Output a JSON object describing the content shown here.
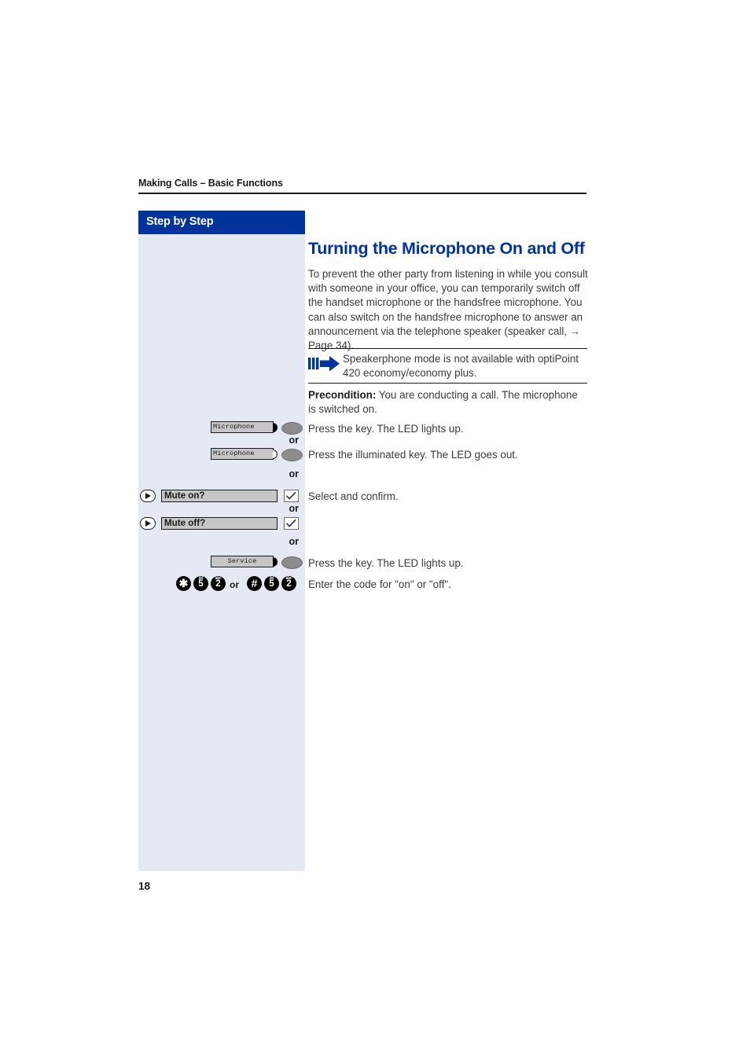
{
  "header": {
    "running_head": "Making Calls – Basic Functions"
  },
  "sidebar": {
    "title": "Step by Step",
    "bg_color": "#e4e9f4",
    "header_color": "#00349a"
  },
  "main": {
    "title": "Turning the Microphone On and Off",
    "title_color": "#00349a",
    "intro": "To prevent the other party from listening in while you consult with someone in your office, you can temporarily switch off the handset microphone or the handsfree microphone. You can also switch on the handsfree microphone to answer an announcement via the telephone speaker (speaker call, → Page 34).",
    "note": {
      "icon": "note-arrow-icon",
      "text": "Speakerphone mode is not available with optiPoint 420 economy/economy plus.",
      "icon_color": "#00349a"
    },
    "precondition_label": "Precondition:",
    "precondition_text": " You are conducting a call. The microphone is switched on."
  },
  "or_label": "or",
  "steps": [
    {
      "type": "function-key",
      "key_label": "Microphone",
      "nib": "filled",
      "led": "on",
      "description": "Press the key. The LED lights up."
    },
    {
      "type": "function-key",
      "key_label": "Microphone",
      "nib": "open",
      "led": "on",
      "description": "Press the illuminated key. The LED goes out."
    },
    {
      "type": "menu-option",
      "option_label": "Mute on?",
      "description": "Select and confirm."
    },
    {
      "type": "menu-option",
      "option_label": "Mute off?",
      "description": ""
    },
    {
      "type": "function-key",
      "key_label": "Service",
      "nib": "filled",
      "led": "on",
      "description": "Press the key. The LED lights up."
    },
    {
      "type": "dial-code",
      "description": "Enter the code for \"on\" or \"off\"."
    }
  ],
  "dial_codes": {
    "first": [
      {
        "glyph": "✱",
        "sub": "",
        "name": "star-key"
      },
      {
        "glyph": "5",
        "sub": "jkl",
        "name": "five-key"
      },
      {
        "glyph": "2",
        "sub": "abc",
        "name": "two-key"
      }
    ],
    "separator": "or",
    "second": [
      {
        "glyph": "#",
        "sub": "",
        "name": "hash-key"
      },
      {
        "glyph": "5",
        "sub": "jkl",
        "name": "five-key"
      },
      {
        "glyph": "2",
        "sub": "abc",
        "name": "two-key"
      }
    ]
  },
  "footer": {
    "page_number": "18"
  }
}
